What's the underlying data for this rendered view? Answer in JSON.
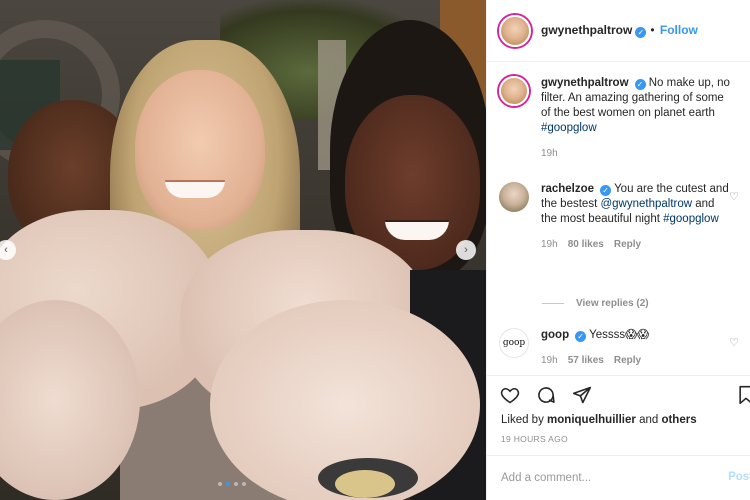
{
  "post": {
    "author": "gwynethpaltrow",
    "follow_label": "Follow",
    "header_separator": "•"
  },
  "photo": {
    "slide_count": 4,
    "active_slide": 1
  },
  "caption": {
    "username": "gwynethpaltrow",
    "text": "No make up, no filter. An amazing gathering of some of the best women on planet earth",
    "hashtag": "#goopglow",
    "age": "19h"
  },
  "comments": [
    {
      "username": "rachelzoe",
      "text_before": "You are the cutest and the bestest",
      "mention": "@gwynethpaltrow",
      "text_after": "and the most beautiful night",
      "hashtag": "#goopglow",
      "age": "19h",
      "likes": "80 likes",
      "reply_label": "Reply",
      "view_replies": "View replies (2)"
    },
    {
      "username": "goop",
      "avatar_text": "goop",
      "text": "Yessss😱😱",
      "age": "19h",
      "likes": "57 likes",
      "reply_label": "Reply"
    }
  ],
  "engagement": {
    "liked_by_prefix": "Liked by",
    "liked_by_user": "moniquelhuillier",
    "liked_by_suffix": "and",
    "liked_by_others": "others",
    "timestamp": "19 HOURS AGO"
  },
  "composer": {
    "placeholder": "Add a comment...",
    "post_label": "Post"
  },
  "icons": {
    "like": "heart-icon",
    "comment": "comment-icon",
    "share": "share-icon",
    "save": "bookmark-icon",
    "comment_like": "heart-outline-icon",
    "verified": "verified-badge-icon",
    "prev": "chevron-left-icon",
    "next": "chevron-right-icon"
  },
  "colors": {
    "accent": "#3897f0",
    "link": "#00376b",
    "muted": "#8e8e8e",
    "story_ring": "#d6249f",
    "post_disabled": "#b2dffc"
  }
}
